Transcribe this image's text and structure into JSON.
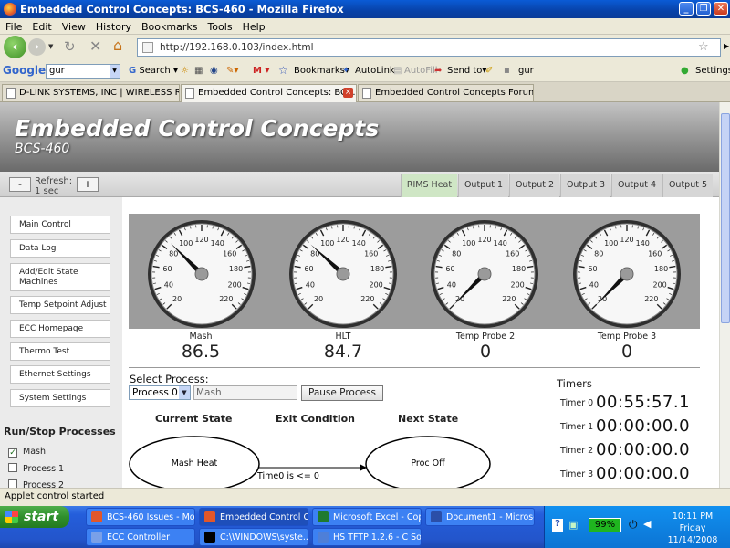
{
  "window": {
    "title": "Embedded Control Concepts: BCS-460 - Mozilla Firefox"
  },
  "menu": [
    "File",
    "Edit",
    "View",
    "History",
    "Bookmarks",
    "Tools",
    "Help"
  ],
  "nav": {
    "url": "http://192.168.0.103/index.html"
  },
  "google_toolbar": {
    "logo": "Google",
    "query": "gur",
    "search_label": "Search",
    "bookmarks_label": "Bookmarks",
    "autolink_label": "AutoLink",
    "autofill_label": "AutoFill",
    "sendto_label": "Send to",
    "gur_label": "gur",
    "settings_label": "Settings"
  },
  "tabs": [
    {
      "label": "D-LINK SYSTEMS, INC | WIRELESS RO..."
    },
    {
      "label": "Embedded Control Concepts: BCS..."
    },
    {
      "label": "Embedded Control Concepts Forum • Vi..."
    }
  ],
  "page": {
    "brand_title": "Embedded Control Concepts",
    "brand_subtitle": "BCS-460",
    "refresh_minus": "-",
    "refresh_plus": "+",
    "refresh_line1": "Refresh:",
    "refresh_line2": "1 sec",
    "output_tabs": [
      "RIMS Heat",
      "Output 1",
      "Output 2",
      "Output 3",
      "Output 4",
      "Output 5"
    ],
    "sidebar": [
      "Main Control",
      "Data Log",
      "Add/Edit State Machines",
      "Temp Setpoint Adjust",
      "ECC Homepage",
      "Thermo Test",
      "Ethernet Settings",
      "System Settings"
    ],
    "run_stop_title": "Run/Stop Processes",
    "processes": [
      {
        "label": "Mash",
        "checked": true,
        "mark": "✓"
      },
      {
        "label": "Process 1",
        "checked": false,
        "mark": ""
      },
      {
        "label": "Process 2",
        "checked": false,
        "mark": ""
      }
    ],
    "gauges": [
      {
        "label": "Mash",
        "value": "86.5"
      },
      {
        "label": "HLT",
        "value": "84.7"
      },
      {
        "label": "Temp Probe 2",
        "value": "0"
      },
      {
        "label": "Temp Probe 3",
        "value": "0"
      }
    ],
    "gauge_ticks": [
      "20",
      "40",
      "60",
      "80",
      "100",
      "120",
      "140",
      "160",
      "180",
      "200",
      "220"
    ],
    "select_process_label": "Select Process:",
    "process_select_value": "Process 0",
    "process_name_value": "Mash",
    "pause_button": "Pause Process",
    "current_state_heading": "Current State",
    "exit_condition_heading": "Exit Condition",
    "next_state_heading": "Next State",
    "current_state": "Mash Heat",
    "exit_condition": "Time0 is <= 0",
    "next_state": "Proc Off",
    "timers_title": "Timers",
    "timers": [
      {
        "label": "Timer 0",
        "value": "00:55:57.1"
      },
      {
        "label": "Timer 1",
        "value": "00:00:00.0"
      },
      {
        "label": "Timer 2",
        "value": "00:00:00.0"
      },
      {
        "label": "Timer 3",
        "value": "00:00:00.0"
      }
    ]
  },
  "status": "Applet control started",
  "taskbar": {
    "start_label": "start",
    "tasks": [
      "BCS-460 Issues - Mo...",
      "Embedded Control C...",
      "Microsoft Excel - Cop...",
      "Document1 - Microso...",
      "ECC Controller",
      "C:\\WINDOWS\\syste...",
      "HS TFTP 1.2.6 - C So..."
    ],
    "battery": "99%",
    "clock_time": "10:11 PM",
    "clock_day": "Friday",
    "clock_date": "11/14/2008"
  }
}
